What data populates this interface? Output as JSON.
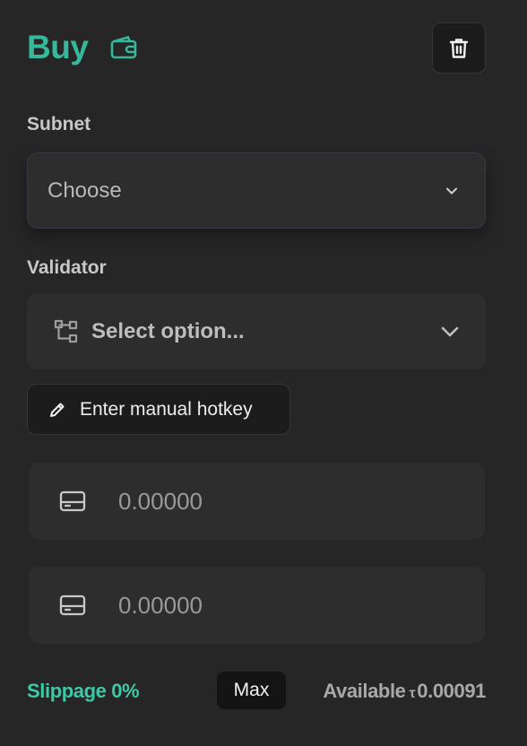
{
  "header": {
    "title": "Buy",
    "wallet_icon": "wallet-icon",
    "delete_icon": "trash-icon"
  },
  "subnet": {
    "label": "Subnet",
    "value": "Choose",
    "chevron_icon": "chevron-down-icon"
  },
  "validator": {
    "label": "Validator",
    "placeholder": "Select option...",
    "tree_icon": "hierarchy-icon",
    "chevron_icon": "chevron-down-icon"
  },
  "hotkey": {
    "label": "Enter manual hotkey",
    "icon": "pencil-icon"
  },
  "amounts": [
    {
      "value": "0.00000",
      "icon": "card-icon"
    },
    {
      "value": "0.00000",
      "icon": "card-icon"
    }
  ],
  "footer": {
    "slippage": "Slippage 0%",
    "max_label": "Max",
    "available_label": "Available",
    "currency_symbol": "τ",
    "available_value": "0.00091"
  },
  "colors": {
    "accent": "#35b99a",
    "background": "#262626",
    "field": "#2d2d2d",
    "button_dark": "#1b1b1b"
  }
}
